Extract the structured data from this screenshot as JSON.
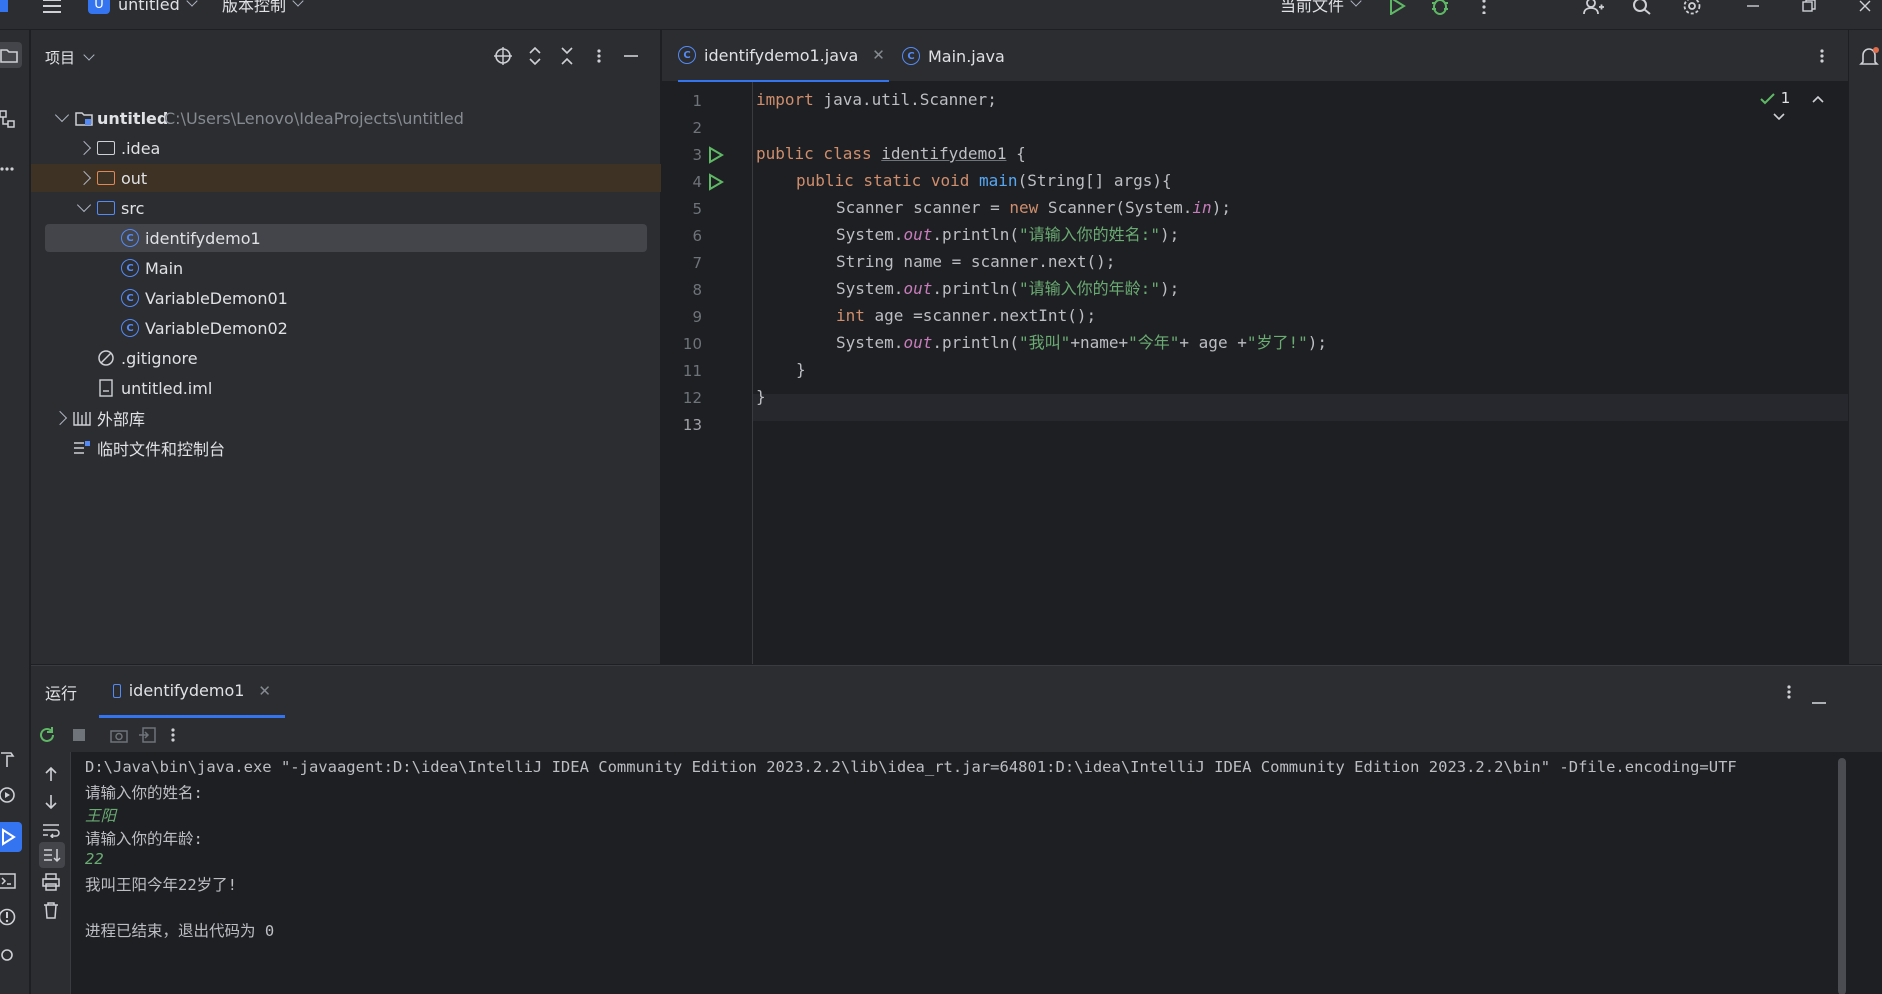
{
  "titlebar": {
    "project_badge": "U",
    "project_name": "untitled",
    "vcs_label": "版本控制",
    "run_config": "当前文件"
  },
  "project_panel": {
    "title": "项目",
    "tree": [
      {
        "label": "untitled",
        "path": "C:\\Users\\Lenovo\\IdeaProjects\\untitled"
      },
      {
        "label": ".idea"
      },
      {
        "label": "out"
      },
      {
        "label": "src"
      },
      {
        "label": "identifydemo1"
      },
      {
        "label": "Main"
      },
      {
        "label": "VariableDemon01"
      },
      {
        "label": "VariableDemon02"
      },
      {
        "label": ".gitignore"
      },
      {
        "label": "untitled.iml"
      },
      {
        "label": "外部库"
      },
      {
        "label": "临时文件和控制台"
      }
    ]
  },
  "editor": {
    "tabs": [
      {
        "label": "identifydemo1.java",
        "close": "✕"
      },
      {
        "label": "Main.java"
      }
    ],
    "inspection_count": "1",
    "line_numbers": [
      "1",
      "2",
      "3",
      "4",
      "5",
      "6",
      "7",
      "8",
      "9",
      "10",
      "11",
      "12",
      "13"
    ],
    "code": {
      "l1_kw": "import",
      "l1_rest": " java.util.Scanner;",
      "l3_kw": "public class",
      "l3_cls": "identifydemo1",
      "l3_rest": " {",
      "l4_kw": "public static void",
      "l4_fn": "main",
      "l4_rest": "(String[] args){",
      "l5_a": "Scanner scanner = ",
      "l5_kw": "new",
      "l5_b": " Scanner(System.",
      "l5_fld": "in",
      "l5_c": ");",
      "l6_a": "System.",
      "l6_fld": "out",
      "l6_b": ".println(",
      "l6_st": "\"请输入你的姓名:\"",
      "l6_c": ");",
      "l7": "String name = scanner.next();",
      "l8_a": "System.",
      "l8_fld": "out",
      "l8_b": ".println(",
      "l8_st": "\"请输入你的年龄:\"",
      "l8_c": ");",
      "l9_kw": "int",
      "l9_rest": " age =scanner.nextInt();",
      "l10_a": "System.",
      "l10_fld": "out",
      "l10_b": ".println(",
      "l10_st1": "\"我叫\"",
      "l10_c": "+name+",
      "l10_st2": "\"今年\"",
      "l10_d": "+ age +",
      "l10_st3": "\"岁了!\"",
      "l10_e": ");",
      "l11": "}",
      "l12": "}"
    }
  },
  "run_panel": {
    "label": "运行",
    "tab": "identifydemo1",
    "tab_close": "✕",
    "console": [
      {
        "text": "D:\\Java\\bin\\java.exe \"-javaagent:D:\\idea\\IntelliJ IDEA Community Edition 2023.2.2\\lib\\idea_rt.jar=64801:D:\\idea\\IntelliJ IDEA Community Edition 2023.2.2\\bin\" -Dfile.encoding=UTF",
        "type": "output"
      },
      {
        "text": "请输入你的姓名:",
        "type": "output"
      },
      {
        "text": "王阳",
        "type": "input"
      },
      {
        "text": "请输入你的年龄:",
        "type": "output"
      },
      {
        "text": "22",
        "type": "input"
      },
      {
        "text": "我叫王阳今年22岁了!",
        "type": "output"
      },
      {
        "text": "",
        "type": "output"
      },
      {
        "text": "进程已结束，退出代码为 0",
        "type": "output"
      }
    ]
  },
  "colors": {
    "accent": "#3574f0",
    "run_green": "#5fb865",
    "keyword": "#cf8e6d",
    "string": "#6aab73",
    "function": "#56a8f5",
    "field": "#c77dbb"
  },
  "icons": [
    "menu-icon",
    "chevron-down-icon",
    "run-icon",
    "debug-icon",
    "more-icon",
    "add-user-icon",
    "search-icon",
    "settings-icon",
    "minimize-icon",
    "restore-icon",
    "notifications-icon",
    "folder-icon",
    "structure-icon",
    "target-icon",
    "expand-icon",
    "collapse-icon",
    "hide-icon",
    "rerun-icon",
    "stop-icon",
    "camera-icon",
    "exit-icon",
    "up-arrow-icon",
    "down-arrow-icon",
    "soft-wrap-icon",
    "scroll-end-icon",
    "print-icon",
    "trash-icon"
  ]
}
